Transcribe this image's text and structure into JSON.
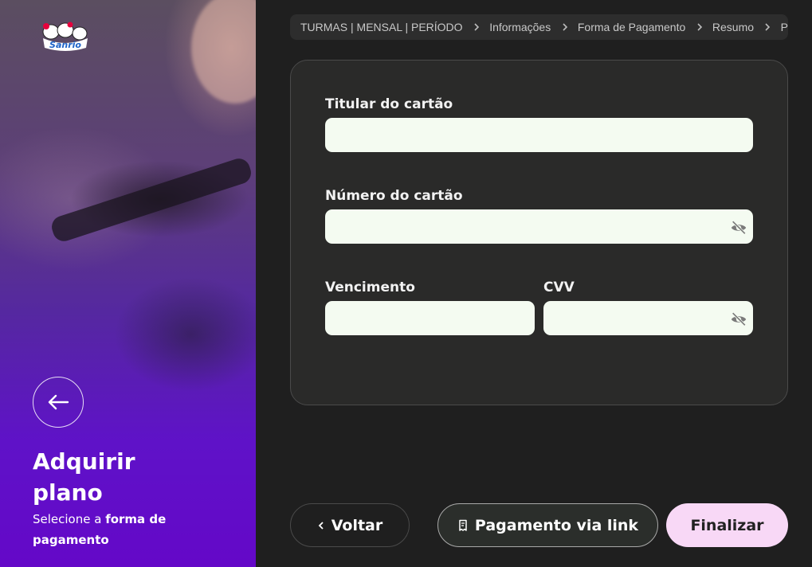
{
  "hero": {
    "logo_text": "Sanrio",
    "title": "Adquirir plano",
    "subtitle_prefix": "Selecione a ",
    "subtitle_bold": "forma de pagamento"
  },
  "breadcrumb": {
    "items": [
      "TURMAS | MENSAL | PERÍODO",
      "Informações",
      "Forma de Pagamento",
      "Resumo",
      "P"
    ]
  },
  "form": {
    "holder_label": "Titular do cartão",
    "holder_value": "",
    "number_label": "Número do cartão",
    "number_value": "",
    "expiry_label": "Vencimento",
    "expiry_value": "",
    "cvv_label": "CVV",
    "cvv_value": ""
  },
  "icons": {
    "visibility": "eye-off-icon",
    "back": "arrow-left-icon",
    "chevron": "chevron-right-icon",
    "link": "receipt-icon"
  },
  "actions": {
    "back_label": "Voltar",
    "link_label": "Pagamento via link",
    "finish_label": "Finalizar"
  },
  "colors": {
    "accent_purple": "#6408c8",
    "finish_bg": "#f8d8f6",
    "input_bg": "#f4fbf1",
    "card_bg": "#2a2a29"
  }
}
